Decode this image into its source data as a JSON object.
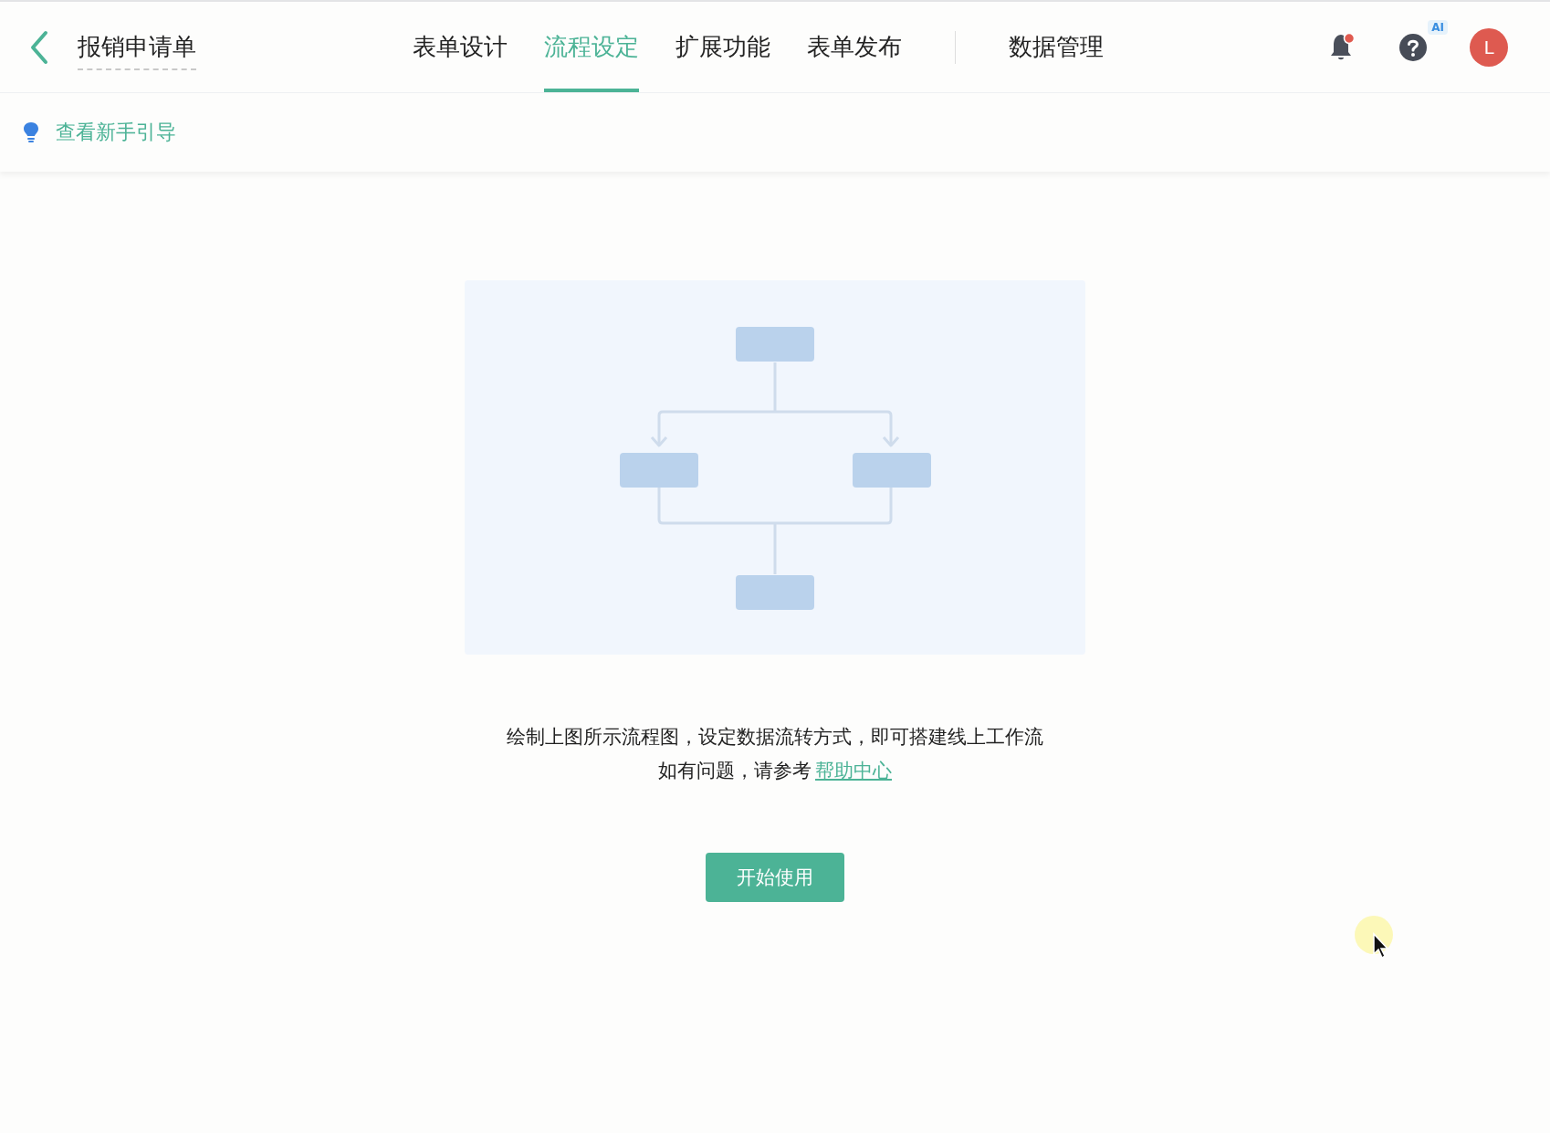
{
  "header": {
    "title": "报销申请单",
    "tabs": [
      {
        "label": "表单设计",
        "selected": false
      },
      {
        "label": "流程设定",
        "selected": true
      },
      {
        "label": "扩展功能",
        "selected": false
      },
      {
        "label": "表单发布",
        "selected": false
      }
    ],
    "extra_tab": {
      "label": "数据管理",
      "selected": false
    },
    "notification_unread": true,
    "help_badge": "AI",
    "avatar_letter": "L"
  },
  "guide_link": "查看新手引导",
  "empty_state": {
    "lines": [
      "绘制上图所示流程图，设定数据流转方式，即可搭建线上工作流"
    ],
    "help_prefix": "如有问题，请参考",
    "help_link": "帮助中心",
    "button": "开始使用"
  }
}
